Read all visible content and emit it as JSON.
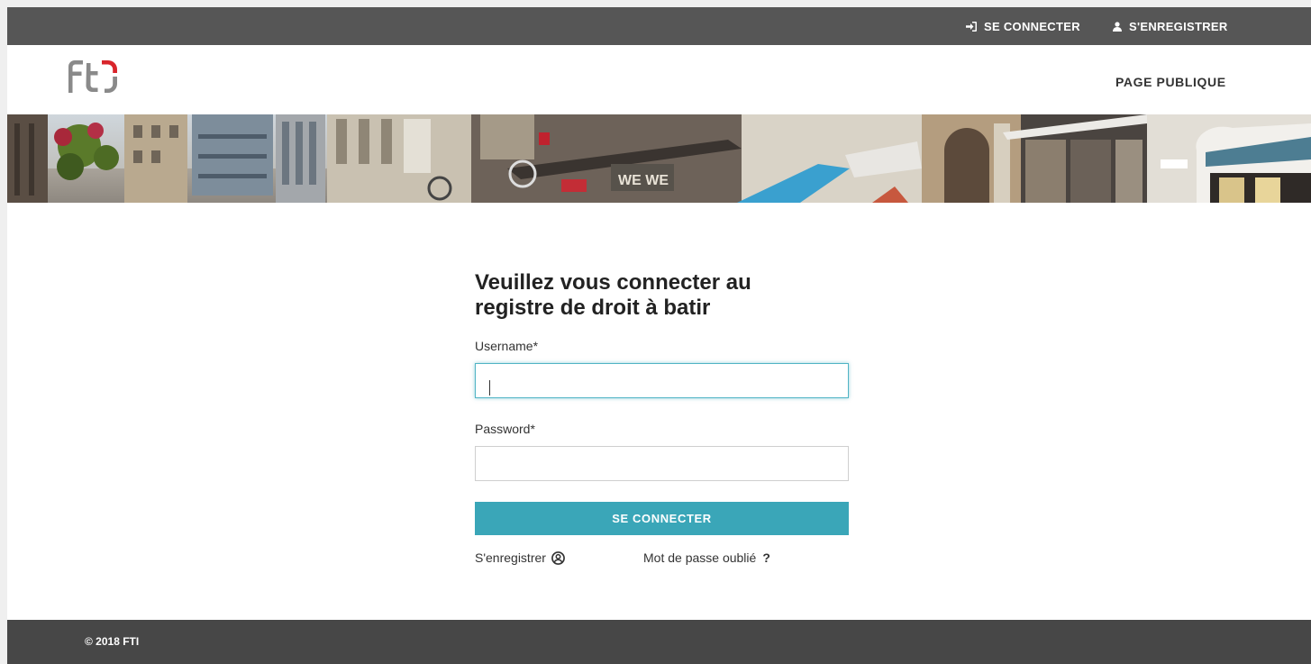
{
  "topbar": {
    "login_label": "SE CONNECTER",
    "register_label": "S'ENREGISTRER"
  },
  "header": {
    "logo_text": "FTI",
    "public_page_label": "PAGE PUBLIQUE"
  },
  "form": {
    "title": "Veuillez vous connecter au registre de droit à batir",
    "username_label": "Username*",
    "username_value": "",
    "password_label": "Password*",
    "password_value": "",
    "submit_label": "SE CONNECTER",
    "register_link": "S'enregistrer",
    "forgot_link": "Mot de passe oublié",
    "forgot_suffix": "?"
  },
  "footer": {
    "copyright": "© 2018 FTI"
  },
  "colors": {
    "topbar": "#565656",
    "accent": "#3aa6b8",
    "footer": "#474747",
    "logo_red": "#d9252b",
    "logo_gray": "#8a8a8a"
  },
  "icons": {
    "login": "sign-in-icon",
    "register": "user-icon",
    "register_bottom": "user-circle-icon"
  }
}
